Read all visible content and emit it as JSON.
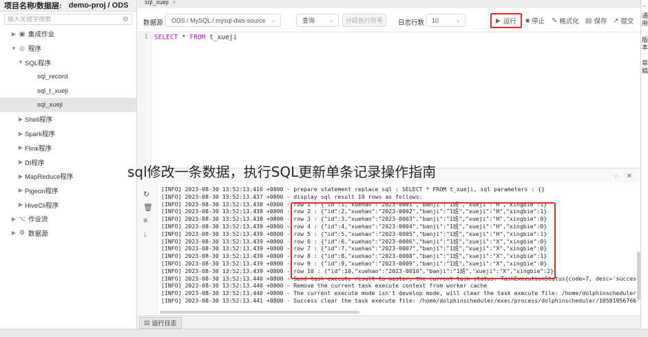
{
  "sidebar": {
    "header_label": "项目名称/数据层:",
    "header_value": "demo-proj / ODS",
    "search_placeholder": "输入关键字搜索",
    "items": [
      {
        "label": "集成作业",
        "arrow": "▶",
        "icon": "▣"
      },
      {
        "label": "程序",
        "arrow": "▼",
        "icon": "◎"
      },
      {
        "label": "SQL程序",
        "arrow": "▼",
        "icon": ""
      },
      {
        "label": "sql_record",
        "arrow": "",
        "icon": ""
      },
      {
        "label": "sql_t_xueji",
        "arrow": "",
        "icon": ""
      },
      {
        "label": "sql_xueji",
        "arrow": "",
        "icon": ""
      },
      {
        "label": "Shell程序",
        "arrow": "▶",
        "icon": ""
      },
      {
        "label": "Spark程序",
        "arrow": "▶",
        "icon": ""
      },
      {
        "label": "Flink程序",
        "arrow": "▶",
        "icon": ""
      },
      {
        "label": "DI程序",
        "arrow": "▶",
        "icon": ""
      },
      {
        "label": "MapReduce程序",
        "arrow": "▶",
        "icon": ""
      },
      {
        "label": "Pigeon程序",
        "arrow": "▶",
        "icon": ""
      },
      {
        "label": "HiveCli程序",
        "arrow": "▶",
        "icon": ""
      },
      {
        "label": "作业流",
        "arrow": "▶",
        "icon": "⌥"
      },
      {
        "label": "数据源",
        "arrow": "▶",
        "icon": "⚙"
      }
    ]
  },
  "tab": {
    "label": "sql_xueji",
    "close": "×"
  },
  "toolbar": {
    "datasource_label": "数据源",
    "datasource_value": "ODS / MySQL / mysql-dws-source",
    "query_value": "查询",
    "segment_button": "分段执行符号",
    "log_rows_label": "日志行数",
    "log_rows_value": "10",
    "run": "运行",
    "stop": "停止",
    "format": "格式化",
    "save": "保存",
    "submit": "提交"
  },
  "editor": {
    "line_number": "1",
    "kw_select": "SELECT",
    "star": " * ",
    "kw_from": "FROM",
    "table": " t_xueji"
  },
  "caption": "sql修改一条数据，执行SQL更新单条记录操作指南",
  "log": {
    "lines": [
      "[INFO] 2023-08-30 13:52:13.416 +0800 - prepare statement replace sql : SELECT * FROM t_xueji, sql parameters : {}",
      "[INFO] 2023-08-30 13:52:13.437 +0800 - display sql result 10 rows as follows:",
      "[INFO] 2023-08-30 13:52:13.438 +0800 - row 1 : {\"id\":1,\"xuehao\":\"2023-0001\",\"banji\":\"1班\",\"xueji\":\"H\",\"xingbie\":1}",
      "[INFO] 2023-08-30 13:52:13.438 +0800 - row 2 : {\"id\":2,\"xuehao\":\"2023-0002\",\"banji\":\"1班\",\"xueji\":\"H\",\"xingbie\":1}",
      "[INFO] 2023-08-30 13:52:13.438 +0800 - row 3 : {\"id\":3,\"xuehao\":\"2023-0003\",\"banji\":\"1班\",\"xueji\":\"H\",\"xingbie\":0}",
      "[INFO] 2023-08-30 13:52:13.439 +0800 - row 4 : {\"id\":4,\"xuehao\":\"2023-0004\",\"banji\":\"1班\",\"xueji\":\"H\",\"xingbie\":0}",
      "[INFO] 2023-08-30 13:52:13.439 +0800 - row 5 : {\"id\":5,\"xuehao\":\"2023-0005\",\"banji\":\"1班\",\"xueji\":\"H\",\"xingbie\":1}",
      "[INFO] 2023-08-30 13:52:13.439 +0800 - row 6 : {\"id\":6,\"xuehao\":\"2023-0006\",\"banji\":\"1班\",\"xueji\":\"X\",\"xingbie\":0}",
      "[INFO] 2023-08-30 13:52:13.439 +0800 - row 7 : {\"id\":7,\"xuehao\":\"2023-0007\",\"banji\":\"1班\",\"xueji\":\"X\",\"xingbie\":0}",
      "[INFO] 2023-08-30 13:52:13.439 +0800 - row 8 : {\"id\":8,\"xuehao\":\"2023-0008\",\"banji\":\"1班\",\"xueji\":\"X\",\"xingbie\":1}",
      "[INFO] 2023-08-30 13:52:13.439 +0800 - row 9 : {\"id\":9,\"xuehao\":\"2023-0009\",\"banji\":\"1班\",\"xueji\":\"X\",\"xingbie\":0}",
      "[INFO] 2023-08-30 13:52:13.439 +0800 - row 10 : {\"id\":10,\"xuehao\":\"2023-0010\",\"banji\":\"1班\",\"xueji\":\"X\",\"xingbie\":2}",
      "[INFO] 2023-08-30 13:52:13.440 +0800 - Send task execute result to master, the current task status: TaskExecutionStatus{code=7, desc='succes",
      "[INFO] 2023-08-30 13:52:13.440 +0800 - Remove the current task execute context from worker cache",
      "[INFO] 2023-08-30 13:52:13.440 +0800 - The current execute mode isn't develop mode, will clear the task execute file: /home/dolphinscheduler",
      "[INFO] 2023-08-30 13:52:13.441 +0800 - Success clear the task execute file: /home/dolphinscheduler/exec/process/dolphinscheduler/10581956766"
    ],
    "bottom_tab": "运行日志"
  },
  "right_edge": [
    "通",
    "用",
    "版",
    "本",
    "草",
    "稿"
  ],
  "colors": {
    "highlight": "#e02a2a",
    "keyword": "#c01dc0"
  }
}
